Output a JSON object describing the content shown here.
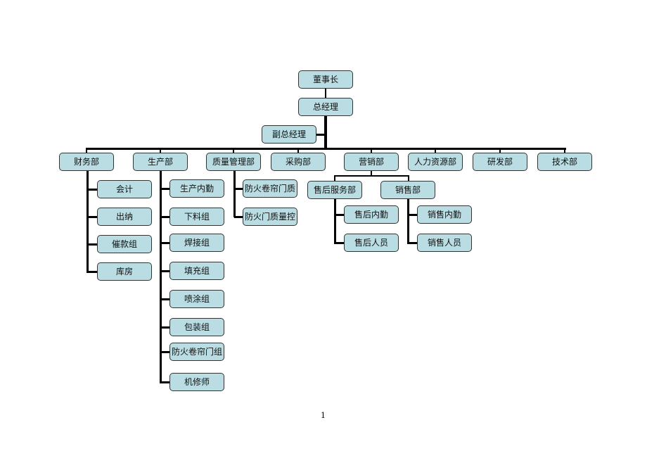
{
  "chairman": "董事长",
  "gm": "总经理",
  "deputy_gm": "副总经理",
  "departments": [
    "财务部",
    "生产部",
    "质量管理部",
    "采购部",
    "营销部",
    "人力资源部",
    "研发部",
    "技术部"
  ],
  "finance": [
    "会计",
    "出纳",
    "催款组",
    "库房"
  ],
  "production": [
    "生产内勤",
    "下料组",
    "焊接组",
    "填充组",
    "喷涂组",
    "包装组",
    "防火卷帘门组",
    "机修师"
  ],
  "quality": [
    "防火卷帘门质量控制",
    "防火门质量控制"
  ],
  "marketing": {
    "after_sales": "售后服务部",
    "sales": "销售部",
    "after_sales_items": [
      "售后内勤",
      "售后人员"
    ],
    "sales_items": [
      "销售内勤",
      "销售人员"
    ]
  },
  "box_color": "#b9dde3",
  "page_number": "1"
}
